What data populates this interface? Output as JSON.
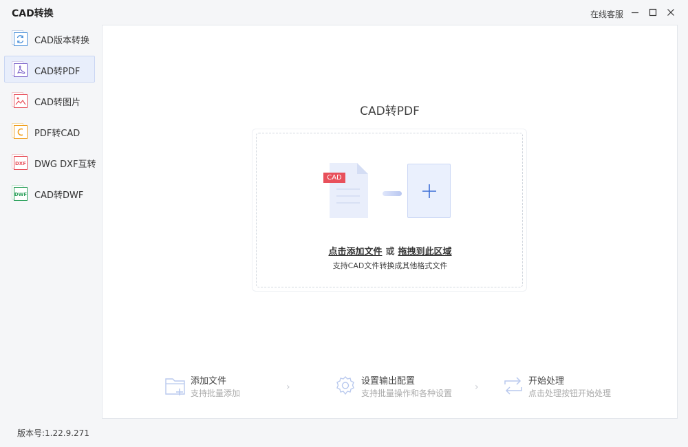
{
  "app": {
    "title": "CAD转换",
    "online_service": "在线客服",
    "version": "版本号:1.22.9.271"
  },
  "window_controls": [
    "minimize",
    "maximize",
    "close"
  ],
  "sidebar": {
    "items": [
      {
        "label": "CAD版本转换",
        "icon": "refresh-doc-icon",
        "active": false,
        "color": "#4a90d9"
      },
      {
        "label": "CAD转PDF",
        "icon": "pdf-doc-icon",
        "active": true,
        "color": "#7b61c9"
      },
      {
        "label": "CAD转图片",
        "icon": "image-doc-icon",
        "active": false,
        "color": "#e8505b"
      },
      {
        "label": "PDF转CAD",
        "icon": "c-doc-icon",
        "active": false,
        "color": "#f0a020"
      },
      {
        "label": "DWG DXF互转",
        "icon": "dxf-doc-icon",
        "active": false,
        "color": "#e8505b"
      },
      {
        "label": "CAD转DWF",
        "icon": "dwf-doc-icon",
        "active": false,
        "color": "#2aa05a"
      }
    ]
  },
  "main": {
    "title": "CAD转PDF",
    "dropzone": {
      "badge": "CAD",
      "add_link": "点击添加文件",
      "or": "或",
      "drag_link": "拖拽到此区域",
      "subtitle": "支持CAD文件转换成其他格式文件"
    },
    "steps": [
      {
        "title": "添加文件",
        "subtitle": "支持批量添加",
        "icon": "folder-add-icon"
      },
      {
        "title": "设置输出配置",
        "subtitle": "支持批量操作和各种设置",
        "icon": "gear-icon"
      },
      {
        "title": "开始处理",
        "subtitle": "点击处理按钮开始处理",
        "icon": "convert-arrows-icon"
      }
    ],
    "chevron": "›"
  },
  "colors": {
    "accent": "#3d6fd6",
    "active_bg": "#e8eefb",
    "badge": "#e8505b"
  }
}
